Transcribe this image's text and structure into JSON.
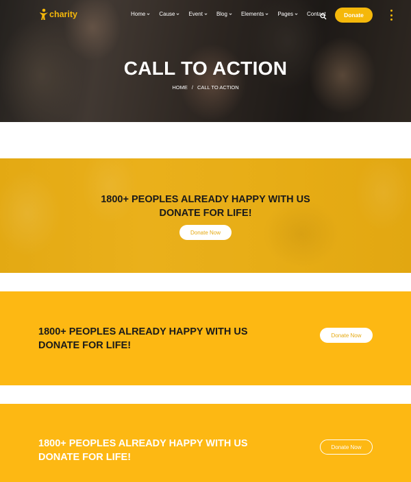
{
  "brand": {
    "name": "charity",
    "accent": "#f5b80b",
    "cta_bg": "#fdb813"
  },
  "nav": {
    "items": [
      {
        "label": "Home",
        "dropdown": true
      },
      {
        "label": "Cause",
        "dropdown": true
      },
      {
        "label": "Event",
        "dropdown": true
      },
      {
        "label": "Blog",
        "dropdown": true
      },
      {
        "label": "Elements",
        "dropdown": true
      },
      {
        "label": "Pages",
        "dropdown": true
      },
      {
        "label": "Contact",
        "dropdown": false
      }
    ],
    "search_icon": "search-icon",
    "donate_label": "Donate",
    "more_icon": "kebab-menu-icon"
  },
  "hero": {
    "title": "CALL TO ACTION",
    "breadcrumb": {
      "home": "HOME",
      "separator": "/",
      "current": "CALL TO ACTION"
    }
  },
  "cta_1": {
    "line1": "1800+ PEOPLES ALREADY HAPPY WITH US",
    "line2": "DONATE FOR LIFE!",
    "button": "Donate Now"
  },
  "cta_2": {
    "line1": "1800+ PEOPLES ALREADY HAPPY WITH US",
    "line2": "DONATE FOR LIFE!",
    "button": "Donate Now"
  },
  "cta_3": {
    "line1": "1800+ PEOPLES ALREADY HAPPY WITH US",
    "line2": "DONATE FOR LIFE!",
    "button": "Donate Now"
  }
}
